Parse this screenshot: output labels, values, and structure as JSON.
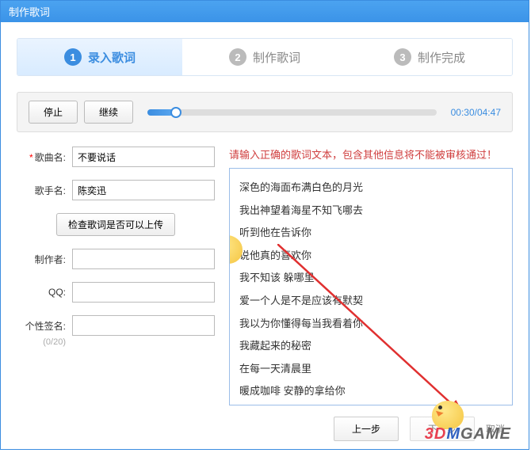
{
  "titlebar": "制作歌词",
  "steps": {
    "s1": {
      "num": "1",
      "label": "录入歌词"
    },
    "s2": {
      "num": "2",
      "label": "制作歌词"
    },
    "s3": {
      "num": "3",
      "label": "制作完成"
    }
  },
  "player": {
    "stop": "停止",
    "resume": "继续",
    "time": "00:30/04:47"
  },
  "form": {
    "song_label": "歌曲名:",
    "song_value": "不要说话",
    "artist_label": "歌手名:",
    "artist_value": "陈奕迅",
    "check_btn": "检查歌词是否可以上传",
    "author_label": "制作者:",
    "author_value": "",
    "qq_label": "QQ:",
    "qq_value": "",
    "sign_label": "个性签名:",
    "sign_value": "",
    "sign_count": "(0/20)"
  },
  "lyrics": {
    "hint": "请输入正确的歌词文本，包含其他信息将不能被审核通过！",
    "lines": [
      "深色的海面布满白色的月光",
      "我出神望着海星不知飞哪去",
      "听到他在告诉你",
      "说他真的喜欢你",
      "我不知该 躲哪里",
      "爱一个人是不是应该有默契",
      "我以为你懂得每当我看着你",
      "我藏起来的秘密",
      "在每一天清晨里",
      "暖成咖啡 安静的拿给你"
    ]
  },
  "footer": {
    "prev": "上一步",
    "next": "下一步",
    "cancel": "取消"
  },
  "watermark": "3DMGAME"
}
